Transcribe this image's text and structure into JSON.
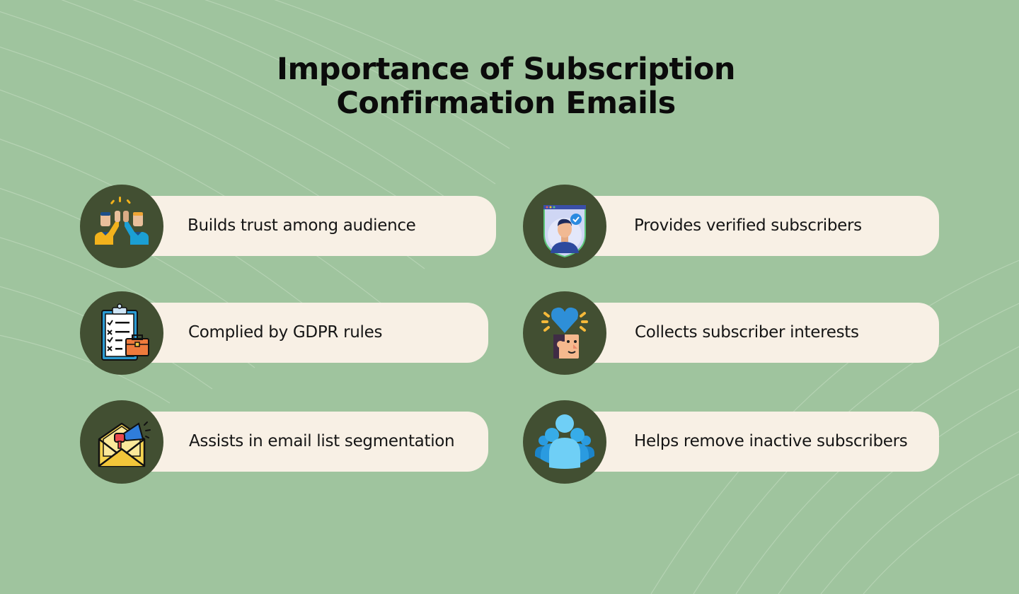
{
  "title": {
    "line1": "Importance of Subscription",
    "line2": "Confirmation Emails"
  },
  "colors": {
    "background": "#9fc49e",
    "pill": "#f8f0e5",
    "icon_circle": "#424f32",
    "text": "#151515"
  },
  "items": [
    {
      "label": "Builds trust among audience",
      "icon": "high-five-icon"
    },
    {
      "label": "Provides verified subscribers",
      "icon": "verified-user-icon"
    },
    {
      "label": "Complied by GDPR rules",
      "icon": "clipboard-checklist-icon"
    },
    {
      "label": "Collects subscriber interests",
      "icon": "heart-head-icon"
    },
    {
      "label": "Assists in email list segmentation",
      "icon": "email-megaphone-icon"
    },
    {
      "label": "Helps remove inactive subscribers",
      "icon": "group-users-icon"
    }
  ]
}
